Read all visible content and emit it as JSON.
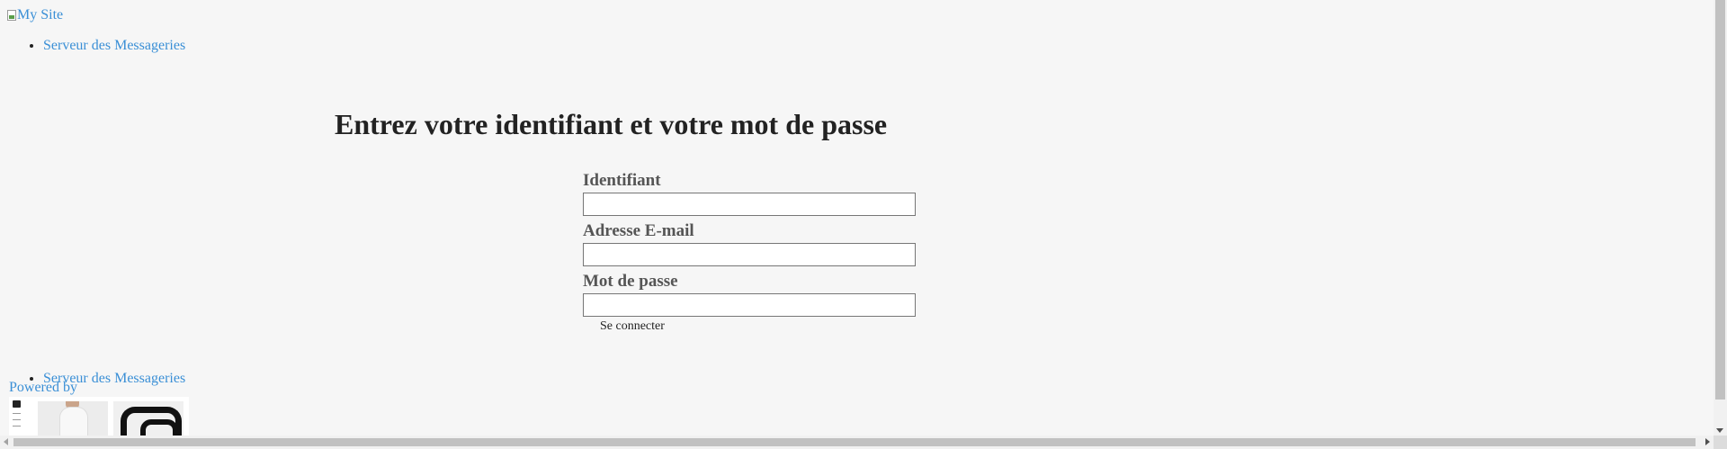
{
  "header": {
    "logo_alt": "My Site",
    "nav_items": [
      {
        "label": "Serveur des Messageries"
      }
    ]
  },
  "main": {
    "title": "Entrez votre identifiant et votre mot de passe",
    "fields": [
      {
        "label": "Identifiant",
        "value": ""
      },
      {
        "label": "Adresse E-mail",
        "value": ""
      },
      {
        "label": "Mot de passe",
        "value": ""
      }
    ],
    "submit_label": "Se connecter"
  },
  "footer": {
    "nav_items": [
      {
        "label": "Serveur des Messageries"
      }
    ],
    "powered_by": "Powered by"
  },
  "icons": [
    "broken-image-icon",
    "chevron-down-icon",
    "chevron-left-icon",
    "chevron-right-icon"
  ],
  "colors": {
    "link": "#3a8fd6",
    "background": "#f6f6f6",
    "title": "#222222",
    "label": "#555555"
  }
}
